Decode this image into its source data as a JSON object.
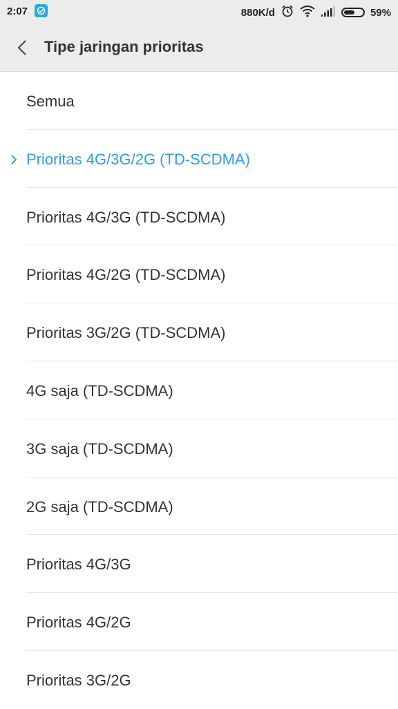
{
  "status_bar": {
    "time": "2:07",
    "network_speed": "880K/d",
    "battery_percent": "59%",
    "battery_level": 0.59,
    "icons": [
      "app-notification-icon",
      "alarm-icon",
      "wifi-icon",
      "signal-icon",
      "battery-icon"
    ]
  },
  "header": {
    "back_icon": "chevron-left-icon",
    "title": "Tipe jaringan prioritas"
  },
  "accent_color": "#2d9ee8",
  "options": [
    {
      "label": "Semua",
      "selected": false
    },
    {
      "label": "Prioritas 4G/3G/2G (TD-SCDMA)",
      "selected": true
    },
    {
      "label": "Prioritas 4G/3G (TD-SCDMA)",
      "selected": false
    },
    {
      "label": "Prioritas 4G/2G (TD-SCDMA)",
      "selected": false
    },
    {
      "label": "Prioritas 3G/2G (TD-SCDMA)",
      "selected": false
    },
    {
      "label": "4G saja (TD-SCDMA)",
      "selected": false
    },
    {
      "label": "3G saja (TD-SCDMA)",
      "selected": false
    },
    {
      "label": "2G saja (TD-SCDMA)",
      "selected": false
    },
    {
      "label": "Prioritas 4G/3G",
      "selected": false
    },
    {
      "label": "Prioritas 4G/2G",
      "selected": false
    },
    {
      "label": "Prioritas 3G/2G",
      "selected": false
    }
  ]
}
